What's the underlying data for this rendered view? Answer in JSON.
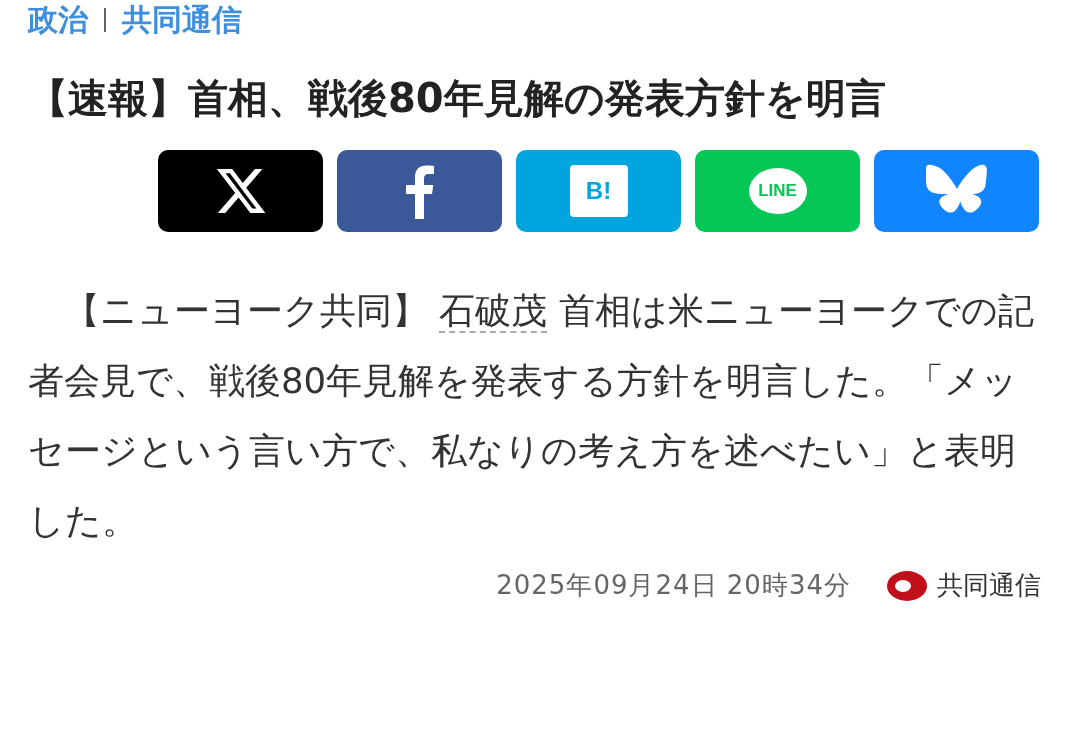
{
  "breadcrumb": [
    {
      "label": "政治"
    },
    {
      "label": "共同通信"
    }
  ],
  "headline": "【速報】首相、戦後80年見解の発表方針を明言",
  "share_buttons": [
    {
      "kind": "x"
    },
    {
      "kind": "facebook"
    },
    {
      "kind": "hatena",
      "label": "B!"
    },
    {
      "kind": "line",
      "label": "LINE"
    },
    {
      "kind": "bluesky"
    }
  ],
  "body": {
    "lead": "【ニューヨーク共同】",
    "link": "石破茂",
    "rest": "首相は米ニューヨークでの記者会見で、戦後80年見解を発表する方針を明言した。「メッセージという言い方で、私なりの考え方を述べたい」と表明した。"
  },
  "timestamp": "2025年09月24日 20時34分",
  "source": "共同通信"
}
